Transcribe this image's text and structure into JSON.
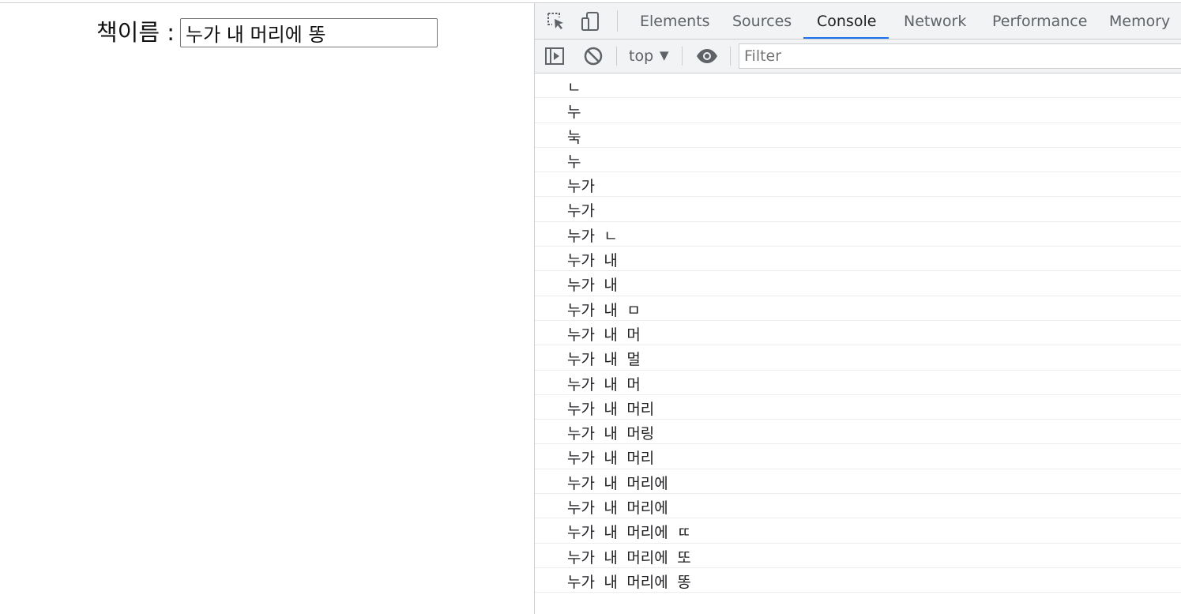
{
  "page": {
    "label": "책이름 :",
    "input_value": "누가 내 머리에 똥"
  },
  "devtools": {
    "tabs": [
      "Elements",
      "Sources",
      "Console",
      "Network",
      "Performance",
      "Memory"
    ],
    "active_tab": "Console",
    "context": "top",
    "filter_placeholder": "Filter",
    "accent_color": "#1a73e8"
  },
  "console_logs": [
    "ㄴ",
    "누",
    "눅",
    "누",
    "누가",
    "누가",
    "누가 ㄴ",
    "누가 내",
    "누가 내",
    "누가 내 ㅁ",
    "누가 내 머",
    "누가 내 멀",
    "누가 내 머",
    "누가 내 머리",
    "누가 내 머링",
    "누가 내 머리",
    "누가 내 머리에",
    "누가 내 머리에",
    "누가 내 머리에 ㄸ",
    "누가 내 머리에 또",
    "누가 내 머리에 똥"
  ]
}
